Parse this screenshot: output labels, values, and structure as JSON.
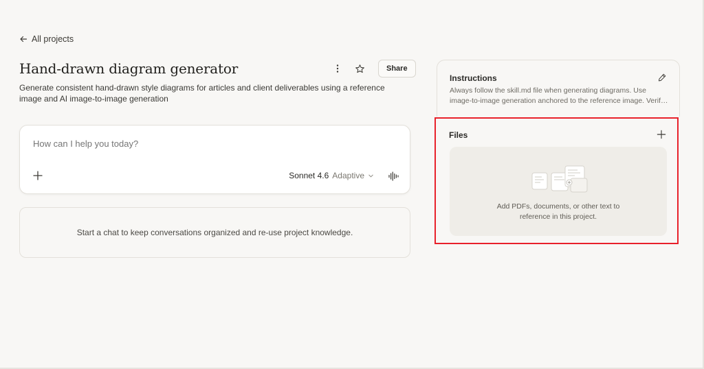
{
  "nav": {
    "back_label": "All projects"
  },
  "project": {
    "title": "Hand-drawn diagram generator",
    "description": "Generate consistent hand-drawn style diagrams for articles and client deliverables using a reference image and AI image-to-image generation",
    "share_label": "Share"
  },
  "chat": {
    "placeholder": "How can I help you today?",
    "model_name": "Sonnet 4.6",
    "model_mode": "Adaptive"
  },
  "empty_state": {
    "text": "Start a chat to keep conversations organized and re-use project knowledge."
  },
  "instructions": {
    "title": "Instructions",
    "line1": "Always follow the skill.md file when generating diagrams. Use",
    "line2": "image-to-image generation anchored to the reference image. Verif…"
  },
  "files": {
    "title": "Files",
    "empty_line1": "Add PDFs, documents, or other text to",
    "empty_line2": "reference in this project."
  },
  "colors": {
    "accent_highlight": "#e8202a",
    "background": "#f8f7f5"
  },
  "icons": [
    "arrow-left-icon",
    "more-vertical-icon",
    "star-icon",
    "plus-icon",
    "chevron-down-icon",
    "voice-wave-icon",
    "pencil-icon",
    "documents-illustration"
  ]
}
